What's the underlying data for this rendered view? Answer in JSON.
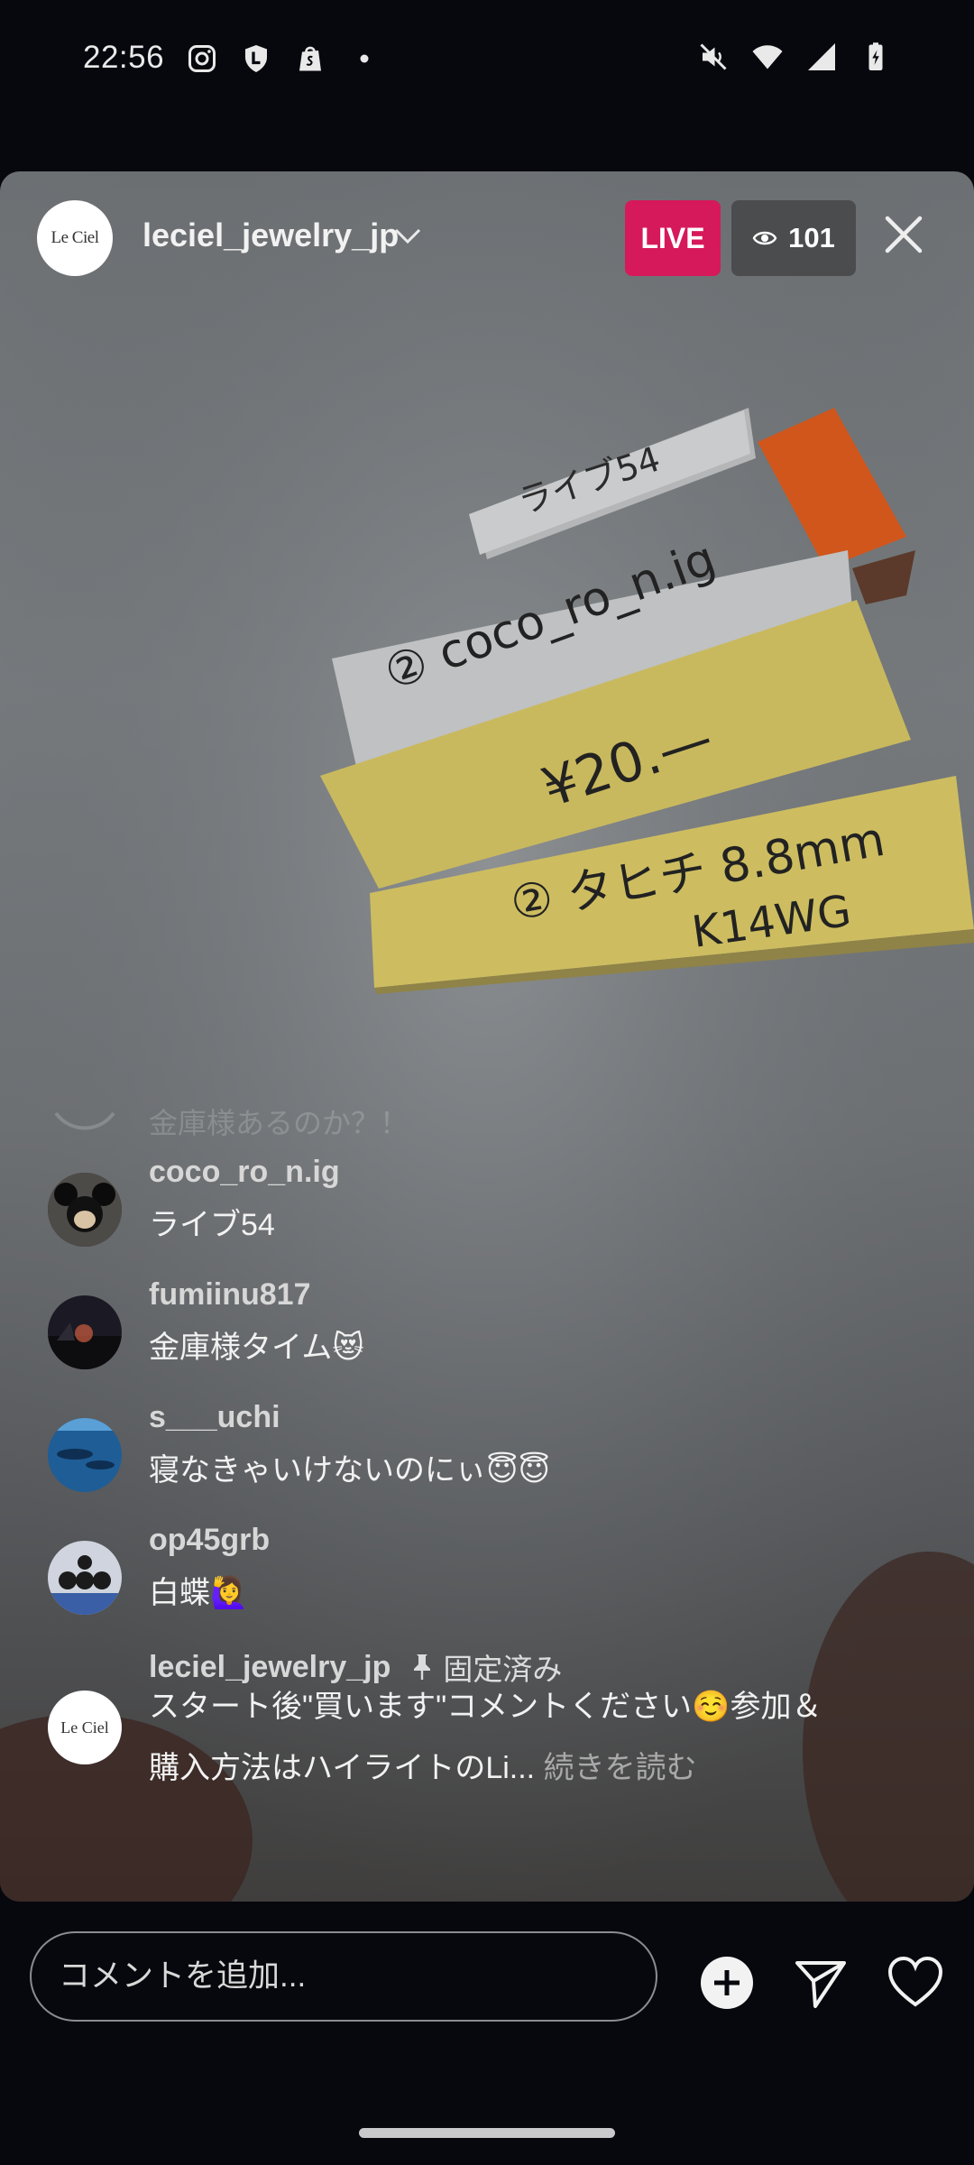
{
  "status_bar": {
    "time": "22:56",
    "left_icons": [
      "instagram-icon",
      "shield-l-icon",
      "shopify-icon",
      "dot-icon"
    ],
    "right_icons": [
      "mute-icon",
      "wifi-icon",
      "signal-icon",
      "battery-charging-icon"
    ]
  },
  "live": {
    "host_name": "leciel_jewelry_jp",
    "host_avatar_text": "Le Ciel",
    "live_label": "LIVE",
    "viewer_count": "101"
  },
  "video_notes": {
    "note1": "ライブ54",
    "note2": "② coco_ro_n.ig",
    "note3": "¥20.—",
    "note4_line1": "② タヒチ 8.8mm",
    "note4_line2": "K14WG"
  },
  "comments": {
    "faded_text": "金庫様あるのか？！",
    "items": [
      {
        "user": "coco_ro_n.ig",
        "text": "ライブ54"
      },
      {
        "user": "fumiinu817",
        "text": "金庫様タイム😻"
      },
      {
        "user": "s___uchi",
        "text": "寝なきゃいけないのにぃ😇😇"
      },
      {
        "user": "op45grb",
        "text": "白蝶🙋‍♀️"
      }
    ],
    "pinned": {
      "user": "leciel_jewelry_jp",
      "pin_label": "固定済み",
      "avatar_text": "Le Ciel",
      "text": "スタート後\"買います\"コメントください☺️参加＆購入方法はハイライトのLi...",
      "read_more": "続きを読む"
    }
  },
  "bottom_bar": {
    "comment_placeholder": "コメントを追加...",
    "icons": [
      "add-circle-icon",
      "send-icon",
      "heart-icon"
    ]
  },
  "colors": {
    "live_badge": "#d6195a",
    "viewer_badge": "#4b4c4d",
    "background": "#07080d"
  }
}
